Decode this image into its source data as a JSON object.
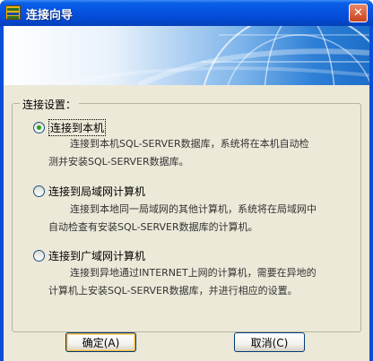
{
  "window": {
    "title": "连接向导",
    "icon": "app-icon",
    "close_glyph": "✕"
  },
  "group": {
    "title": "连接设置："
  },
  "options": [
    {
      "label": "连接到本机",
      "checked": true,
      "desc_line1": "连接到本机SQL-SERVER数据库，系统将在本机自动检",
      "desc_line2": "测并安装SQL-SERVER数据库。"
    },
    {
      "label": "连接到局域网计算机",
      "checked": false,
      "desc_line1": "连接到本地同一局域网的其他计算机，系统将在局域网中",
      "desc_line2": "自动检查有安装SQL-SERVER数据库的计算机。"
    },
    {
      "label": "连接到广域网计算机",
      "checked": false,
      "desc_line1": "连接到异地通过INTERNET上网的计算机，需要在异地的",
      "desc_line2": "计算机上安装SQL-SERVER数据库，并进行相应的设置。"
    }
  ],
  "buttons": {
    "ok": "确定(A)",
    "cancel": "取消(C)"
  },
  "colors": {
    "titlebar": "#0552e0",
    "dialog_bg": "#ece9d8",
    "radio_dot": "#21a121"
  }
}
